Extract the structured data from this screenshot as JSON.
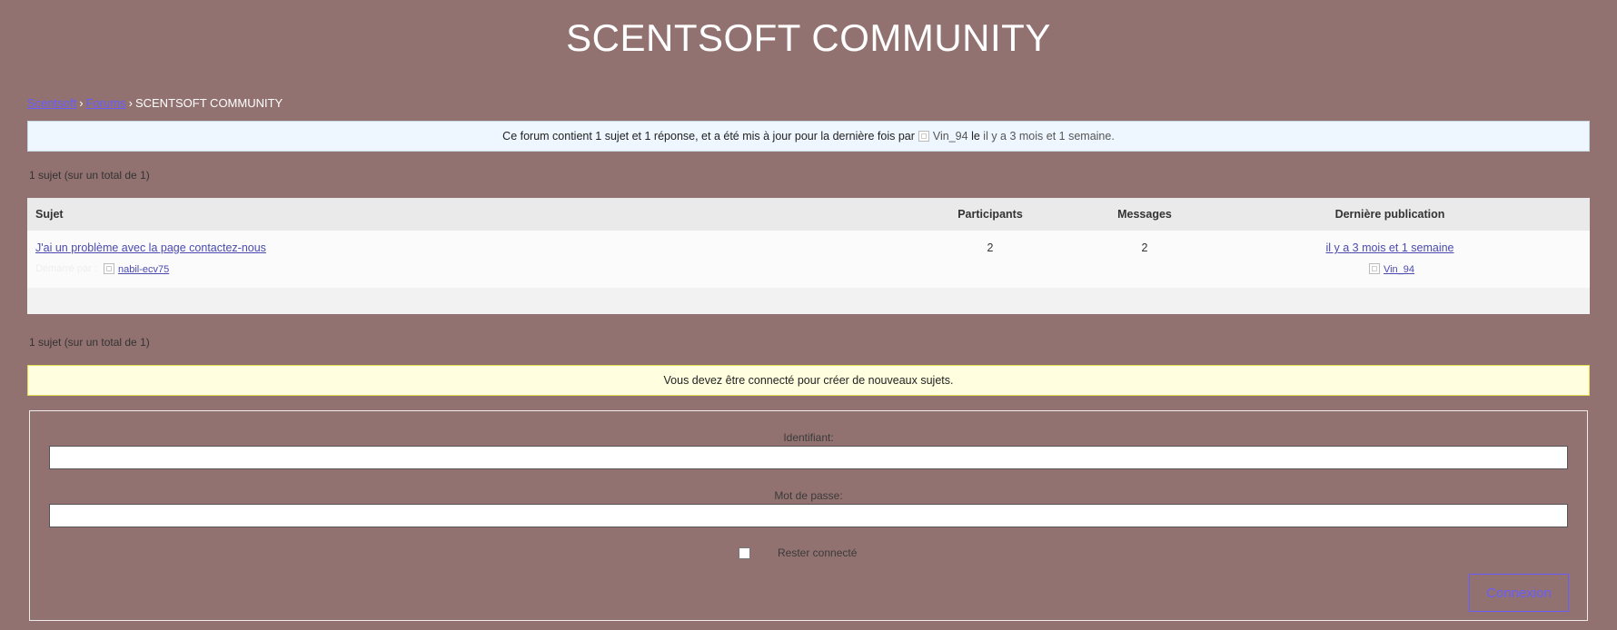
{
  "site": {
    "title": "SCENTSOFT COMMUNITY"
  },
  "breadcrumb": {
    "home": "Scentsoft",
    "forums": "Forums",
    "separator": "›",
    "current": "SCENTSOFT COMMUNITY"
  },
  "forum_info": {
    "prefix": "Ce forum contient 1 sujet et 1 réponse, et a été mis à jour pour la dernière fois par",
    "user": "Vin_94",
    "le": "le",
    "time": "il y a 3 mois et 1 semaine."
  },
  "pagination": {
    "count_label": "1 sujet (sur un total de 1)"
  },
  "table": {
    "headers": {
      "subject": "Sujet",
      "participants": "Participants",
      "messages": "Messages",
      "last": "Dernière publication"
    },
    "rows": [
      {
        "title": "J'ai un problème avec la page contactez-nous",
        "started_by": "Démarré par :",
        "author": "nabil-ecv75",
        "participants": "2",
        "messages": "2",
        "last_time": "il y a 3 mois et 1 semaine",
        "last_author": "Vin_94"
      }
    ]
  },
  "notice": {
    "text": "Vous devez être connecté pour créer de nouveaux sujets."
  },
  "login": {
    "username_label": "Identifiant:",
    "password_label": "Mot de passe:",
    "remember_label": "Rester connecté",
    "submit_label": "Connexion"
  },
  "colors": {
    "background": "#927270",
    "link": "#6a5cff",
    "info_bg": "#eef7ff",
    "notice_bg": "#ffffe0"
  },
  "icons": {
    "avatar": "avatar-icon"
  }
}
